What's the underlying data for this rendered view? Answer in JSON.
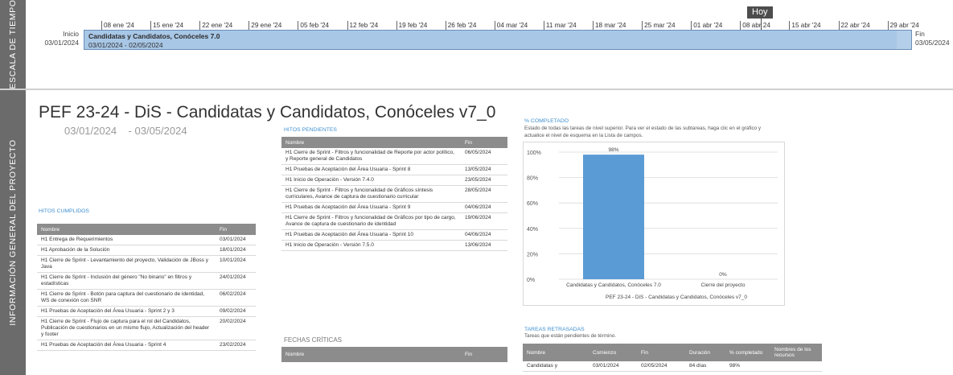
{
  "sidebar": {
    "timeline_label": "ESCALA DE TIEMPO",
    "info_label": "INFORMACIÓN GENERAL DEL PROYECTO"
  },
  "timeline": {
    "ticks": [
      "08 ene '24",
      "15 ene '24",
      "22 ene '24",
      "29 ene '24",
      "05 feb '24",
      "12 feb '24",
      "19 feb '24",
      "26 feb '24",
      "04 mar '24",
      "11 mar '24",
      "18 mar '24",
      "25 mar '24",
      "01 abr '24",
      "08 abr 24",
      "15 abr '24",
      "22 abr '24",
      "29 abr '24"
    ],
    "today": "Hoy",
    "start_label": "Inicio",
    "start_date": "03/01/2024",
    "end_label": "Fin",
    "end_date": "03/05/2024",
    "task_name": "Candidatas y Candidatos, Conóceles 7.0",
    "task_dates": "03/01/2024 - 02/05/2024"
  },
  "project": {
    "title": "PEF 23-24 - DiS - Candidatas y Candidatos, Conóceles v7_0",
    "start": "03/01/2024",
    "dash": "-",
    "end": "03/05/2024"
  },
  "hitos_cumplidos": {
    "title": "HITOS CUMPLIDOS",
    "headers": [
      "Nombre",
      "Fin"
    ],
    "rows": [
      [
        "H1 Entrega de Requerimientos",
        "03/01/2024"
      ],
      [
        "H1 Aprobación de la Solución",
        "18/01/2024"
      ],
      [
        "H1 Cierre de Sprint - Levantamiento del proyecto, Validación de JBoss y Java",
        "10/01/2024"
      ],
      [
        "H1 Cierre de Sprint - Inclusión del género \"No binario\" en filtros y estadísticas",
        "24/01/2024"
      ],
      [
        "H1 Cierre de Sprint - Botón para captura del cuestionario de identidad, WS de conexión con SNR",
        "06/02/2024"
      ],
      [
        "H1 Pruebas de Aceptación del Área Usuaria - Sprint 2 y 3",
        "09/02/2024"
      ],
      [
        "H1 Cierre de Sprint - Flujo de captura para el rol del Candidatos, Publicación de cuestionarios en un mismo flujo, Actualización del header y footer",
        "20/02/2024"
      ],
      [
        "H1 Pruebas de Aceptación del Área Usuaria - Sprint 4",
        "23/02/2024"
      ]
    ]
  },
  "hitos_pendientes": {
    "title": "HITOS PENDIENTES",
    "headers": [
      "Nombre",
      "Fin"
    ],
    "rows": [
      [
        "H1 Cierre de Sprint - Filtros y funcionalidad de Reporte por actor político, y Reporte general de Candidatos",
        "06/05/2024"
      ],
      [
        "H1 Pruebas de Aceptación del Área Usuaria - Sprint 8",
        "13/05/2024"
      ],
      [
        "H1 Inicio de Operación - Versión 7.4.0",
        "23/05/2024"
      ],
      [
        "H1 Cierre de Sprint - Filtros y funcionalidad de Gráficos síntesis curriculares, Avance de captura de cuestionario curricular",
        "28/05/2024"
      ],
      [
        "H1 Pruebas de Aceptación del Área Usuaria - Sprint 9",
        "04/06/2024"
      ],
      [
        "H1 Cierre de Sprint - Filtros y funcionalidad de Gráficos por tipo de cargo, Avance de captura de cuestionario de identidad",
        "19/06/2024"
      ],
      [
        "H1 Pruebas de Aceptación del Área Usuaria - Sprint 10",
        "04/06/2024"
      ],
      [
        "H1 Inicio de Operación - Versión 7.5.0",
        "13/06/2024"
      ]
    ]
  },
  "fechas_criticas": {
    "title": "FECHAS CRÍTICAS",
    "headers": [
      "Nombre",
      "Fin"
    ]
  },
  "completado": {
    "title": "% COMPLETADO",
    "description": "Estado de todas las tareas de nivel superior. Para ver el estado de las subtareas, haga clic en el gráfico y actualice el nivel de esquema en la Lista de campos."
  },
  "chart_data": {
    "type": "bar",
    "categories": [
      "Candidatas y Candidatos, Conóceles 7.0",
      "Cierre del proyecto"
    ],
    "values": [
      98,
      0
    ],
    "value_labels": [
      "98%",
      "0%"
    ],
    "ylim": [
      0,
      100
    ],
    "yticks": [
      "0%",
      "20%",
      "40%",
      "60%",
      "80%",
      "100%"
    ],
    "xlabel": "PEF 23-24 - DiS - Candidatas y Candidatos, Conóceles v7_0",
    "bar_color": "#5b9bd5",
    "grid": true
  },
  "retrasadas": {
    "title": "TAREAS RETRASADAS",
    "subtitle": "Tareas que están pendientes de término.",
    "headers": [
      "Nombre",
      "Comienzo",
      "Fin",
      "Duración",
      "% completado",
      "Nombres de los recursos"
    ],
    "rows": [
      [
        "Candidatas y",
        "03/01/2024",
        "02/05/2024",
        "84 días",
        "98%",
        ""
      ]
    ]
  }
}
